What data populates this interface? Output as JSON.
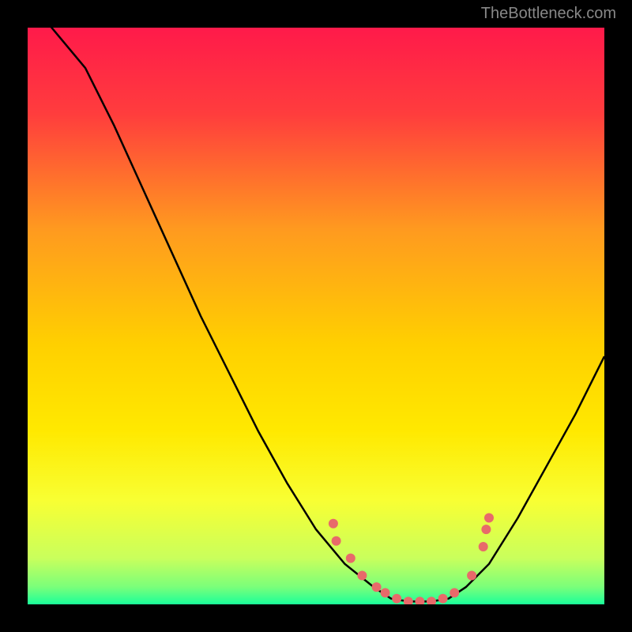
{
  "watermark": "TheBottleneck.com",
  "chart_data": {
    "type": "line",
    "title": "",
    "xlabel": "",
    "ylabel": "",
    "xlim": [
      0,
      100
    ],
    "ylim": [
      0,
      100
    ],
    "gradient_stops": [
      {
        "offset": 0,
        "color": "#ff1a4a"
      },
      {
        "offset": 15,
        "color": "#ff3d3d"
      },
      {
        "offset": 35,
        "color": "#ff9a1f"
      },
      {
        "offset": 55,
        "color": "#ffd000"
      },
      {
        "offset": 70,
        "color": "#ffe900"
      },
      {
        "offset": 82,
        "color": "#f8ff33"
      },
      {
        "offset": 92,
        "color": "#c9ff5c"
      },
      {
        "offset": 97,
        "color": "#7aff7a"
      },
      {
        "offset": 100,
        "color": "#1aff9a"
      }
    ],
    "series": [
      {
        "name": "bottleneck-curve",
        "color": "#000000",
        "points": [
          {
            "x": 0,
            "y": 105
          },
          {
            "x": 5,
            "y": 99
          },
          {
            "x": 10,
            "y": 93
          },
          {
            "x": 15,
            "y": 83
          },
          {
            "x": 20,
            "y": 72
          },
          {
            "x": 25,
            "y": 61
          },
          {
            "x": 30,
            "y": 50
          },
          {
            "x": 35,
            "y": 40
          },
          {
            "x": 40,
            "y": 30
          },
          {
            "x": 45,
            "y": 21
          },
          {
            "x": 50,
            "y": 13
          },
          {
            "x": 55,
            "y": 7
          },
          {
            "x": 60,
            "y": 3
          },
          {
            "x": 63,
            "y": 1
          },
          {
            "x": 66,
            "y": 0.5
          },
          {
            "x": 70,
            "y": 0.5
          },
          {
            "x": 73,
            "y": 1
          },
          {
            "x": 76,
            "y": 3
          },
          {
            "x": 80,
            "y": 7
          },
          {
            "x": 85,
            "y": 15
          },
          {
            "x": 90,
            "y": 24
          },
          {
            "x": 95,
            "y": 33
          },
          {
            "x": 100,
            "y": 43
          }
        ]
      }
    ],
    "markers": {
      "name": "highlight-dots",
      "color": "#e86a6a",
      "radius": 6,
      "points": [
        {
          "x": 53,
          "y": 14
        },
        {
          "x": 53.5,
          "y": 11
        },
        {
          "x": 56,
          "y": 8
        },
        {
          "x": 58,
          "y": 5
        },
        {
          "x": 60.5,
          "y": 3
        },
        {
          "x": 62,
          "y": 2
        },
        {
          "x": 64,
          "y": 1
        },
        {
          "x": 66,
          "y": 0.5
        },
        {
          "x": 68,
          "y": 0.5
        },
        {
          "x": 70,
          "y": 0.5
        },
        {
          "x": 72,
          "y": 1
        },
        {
          "x": 74,
          "y": 2
        },
        {
          "x": 77,
          "y": 5
        },
        {
          "x": 79,
          "y": 10
        },
        {
          "x": 79.5,
          "y": 13
        },
        {
          "x": 80,
          "y": 15
        }
      ]
    }
  }
}
